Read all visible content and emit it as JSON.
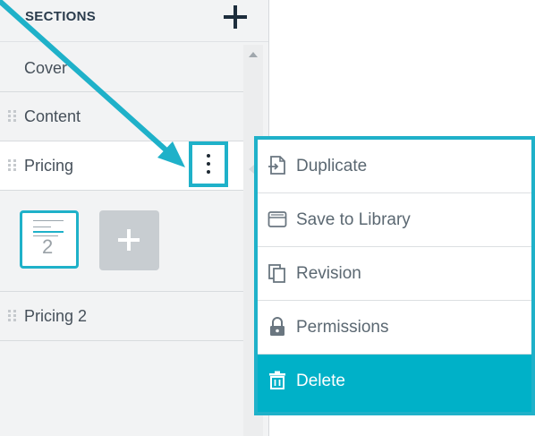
{
  "sidebar": {
    "title": "SECTIONS",
    "sections": [
      {
        "label": "Cover"
      },
      {
        "label": "Content"
      },
      {
        "label": "Pricing"
      },
      {
        "label": "Pricing 2"
      }
    ],
    "active_section": "Pricing",
    "page_thumbnail": {
      "number": "2"
    }
  },
  "context_menu": {
    "items": [
      {
        "label": "Duplicate",
        "icon": "duplicate-icon"
      },
      {
        "label": "Save to Library",
        "icon": "archive-box-icon"
      },
      {
        "label": "Revision",
        "icon": "copies-icon"
      },
      {
        "label": "Permissions",
        "icon": "lock-icon"
      },
      {
        "label": "Delete",
        "icon": "trash-icon"
      }
    ]
  },
  "colors": {
    "accent": "#1fb1c9",
    "delete_bg": "#00b1c8",
    "sidebar_bg": "#f2f3f4"
  }
}
